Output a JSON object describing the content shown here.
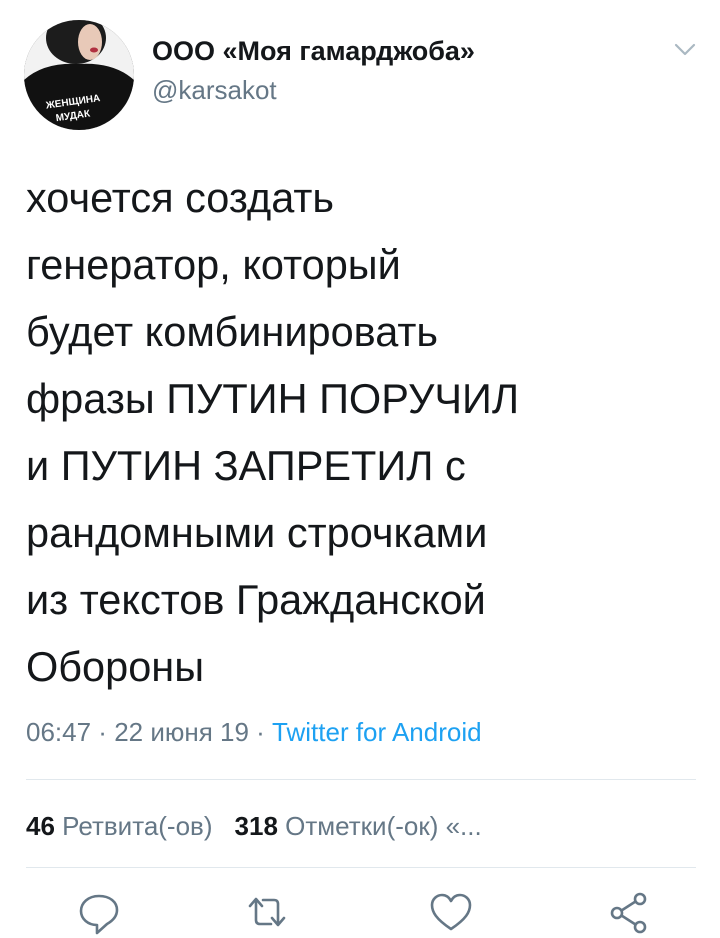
{
  "user": {
    "display_name": "ООО «Моя гамарджоба»",
    "handle": "@karsakot",
    "avatar_text_line1": "ЖЕНЩИНА",
    "avatar_text_line2": "МУДАК"
  },
  "tweet": {
    "text": "хочется создать\nгенератор, который\nбудет комбинировать\nфразы ПУТИН ПОРУЧИЛ\nи ПУТИН ЗАПРЕТИЛ с\nрандомными строчками\nиз текстов Гражданской\nОбороны",
    "time": "06:47",
    "separator1": " · ",
    "date": "22 июня 19",
    "separator2": " · ",
    "source": "Twitter for Android"
  },
  "stats": {
    "retweets_count": "46",
    "retweets_label": "Ретвита(-ов)",
    "likes_count": "318",
    "likes_label": "Отметки(-ок) «..."
  },
  "icons": {
    "menu": "chevron-down-icon",
    "reply": "reply-icon",
    "retweet": "retweet-icon",
    "like": "heart-icon",
    "share": "share-icon"
  },
  "colors": {
    "text": "#14171a",
    "secondary": "#657786",
    "link": "#1da1f2",
    "divider": "#e1e8ed"
  }
}
